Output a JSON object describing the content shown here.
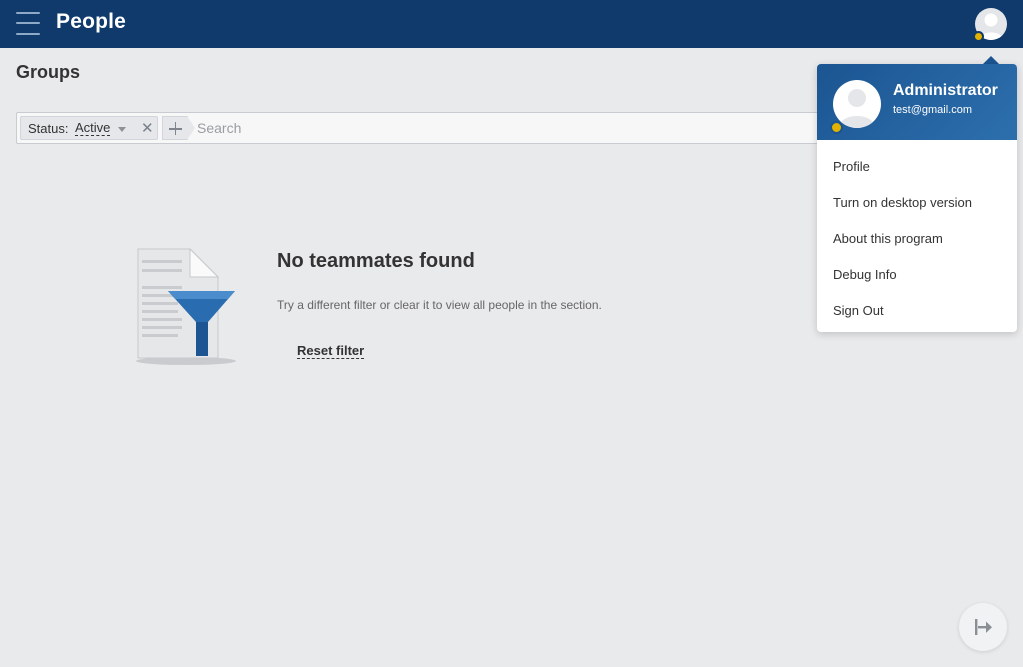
{
  "header": {
    "menu_icon": "hamburger-icon",
    "title": "People",
    "avatar_icon": "user-avatar-icon",
    "badge_color": "#e3b200",
    "background_color": "#0f3a6b"
  },
  "page": {
    "heading": "Groups"
  },
  "filter": {
    "chip_label": "Status:",
    "chip_value": "Active",
    "remove_icon": "close-icon",
    "remove_glyph": "✕",
    "add_icon": "plus-icon",
    "search_placeholder": "Search"
  },
  "empty_state": {
    "illustration_icon": "document-filter-icon",
    "title": "No teammates found",
    "description": "Try a different filter or clear it to view all people in the section.",
    "reset_label": "Reset filter"
  },
  "profile_menu": {
    "name": "Administrator",
    "email": "test@gmail.com",
    "header_color": "#1b5592",
    "items": [
      {
        "label": "Profile"
      },
      {
        "label": "Turn on desktop version"
      },
      {
        "label": "About this program"
      },
      {
        "label": "Debug Info"
      },
      {
        "label": "Sign Out"
      }
    ]
  },
  "collapse_button": {
    "icon": "collapse-arrow-icon"
  }
}
